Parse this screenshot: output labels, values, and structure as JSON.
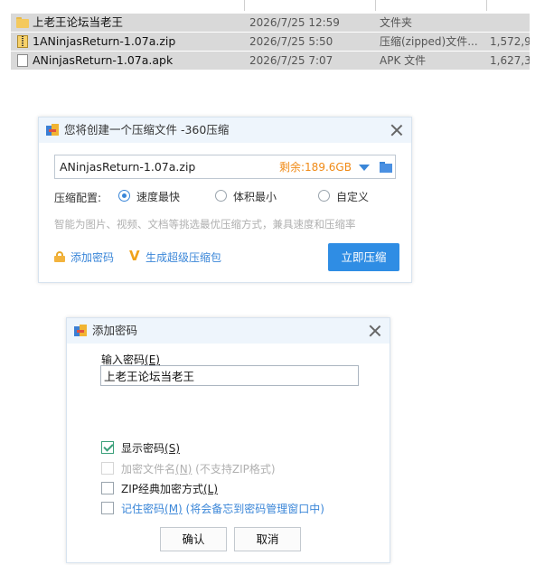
{
  "files": [
    {
      "name": "上老王论坛当老王",
      "date": "2026/7/25 12:59",
      "type": "文件夹",
      "size": "",
      "icon": "folder-icon",
      "selected": true
    },
    {
      "name": "1ANinjasReturn-1.07a.zip",
      "date": "2026/7/25 5:50",
      "type": "压缩(zipped)文件...",
      "size": "1,572,96",
      "icon": "zip-icon",
      "selected": true
    },
    {
      "name": "ANinjasReturn-1.07a.apk",
      "date": "2026/7/25 7:07",
      "type": "APK 文件",
      "size": "1,627,37",
      "icon": "doc-icon",
      "selected": true
    }
  ],
  "compress_dialog": {
    "title": "您将创建一个压缩文件 -360压缩",
    "filename": "ANinjasReturn-1.07a.zip",
    "free_space": "剩余:189.6GB",
    "config_label": "压缩配置:",
    "options": [
      {
        "label": "速度最快",
        "selected": true
      },
      {
        "label": "体积最小",
        "selected": false
      },
      {
        "label": "自定义",
        "selected": false
      }
    ],
    "hint": "智能为图片、视频、文档等挑选最优压缩方式，兼具速度和压缩率",
    "add_password": "添加密码",
    "super_package": "生成超级压缩包",
    "compress_button": "立即压缩",
    "accent_color": "#2f8de4",
    "free_color": "#f08a16"
  },
  "password_dialog": {
    "title": "添加密码",
    "input_label": "输入密码",
    "input_label_key": "(E)",
    "password_value": "上老王论坛当老王",
    "show_password": {
      "label": "显示密码",
      "key": "(S)",
      "checked": true
    },
    "encrypt_names": {
      "label": "加密文件名",
      "key": "(N)",
      "note": " (不支持ZIP格式)",
      "checked": false,
      "disabled": true
    },
    "zip_classic": {
      "label": "ZIP经典加密方式",
      "key": "(L)",
      "checked": false
    },
    "remember": {
      "label": "记住密码",
      "key": "(M)",
      "note": " (将会备忘到密码管理窗口中)",
      "checked": false
    },
    "ok_button": "确认",
    "cancel_button": "取消"
  }
}
